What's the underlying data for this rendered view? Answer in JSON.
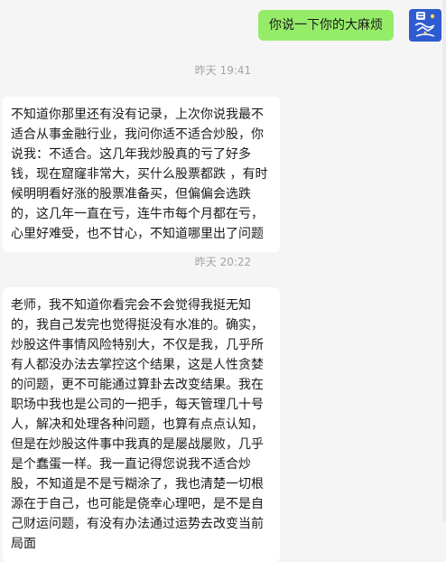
{
  "outgoing": {
    "text": "你说一下你的大麻烦"
  },
  "avatar": {
    "icon": "wealth-avatar-icon",
    "colors": {
      "bg": "#2f5bd0",
      "fg": "#ffffff"
    }
  },
  "timestamps": [
    "昨天 19:41",
    "昨天 20:22"
  ],
  "incoming": [
    {
      "lines": [
        "不知道你那里还有没有记录，上次你说我最不",
        "适合从事金融行业，我问你适不适合炒股，你",
        "说我：不适合。这几年我炒股真的亏了好多",
        "钱，现在窟窿非常大，买什么股票都跌 ，有时",
        "候明明看好涨的股票准备买，但偏偏会选跌",
        "的，这几年一直在亏，连牛市每个月都在亏，",
        "心里好难受，也不甘心，不知道哪里出了问题"
      ]
    },
    {
      "lines": [
        "老师，我不知道你看完会不会觉得我挺无知",
        "的，我自己发完也觉得挺没有水准的。确实，",
        "炒股这件事情风险特别大，不仅是我，几乎所",
        "有人都没办法去掌控这个结果，这是人性贪婪",
        "的问题，更不可能通过算卦去改变结果。我在",
        "职场中我也是公司的一把手，每天管理几十号",
        "人，解决和处理各种问题，也算有点点认知，",
        "但是在炒股这件事中我真的是屡战屡败，几乎",
        "是个蠢蛋一样。我一直记得您说我不适合炒",
        "股，不知道是不是亏糊涂了，我也清楚一切根",
        "源在于自己，也可能是侥幸心理吧，是不是自",
        "己财运问题，有没有办法通过运势去改变当前",
        "局面"
      ]
    }
  ],
  "colors": {
    "background": "#f5f5f5",
    "outgoing_bubble": "#95ec69",
    "incoming_bubble": "#ffffff",
    "timestamp": "#a3a3a3"
  }
}
